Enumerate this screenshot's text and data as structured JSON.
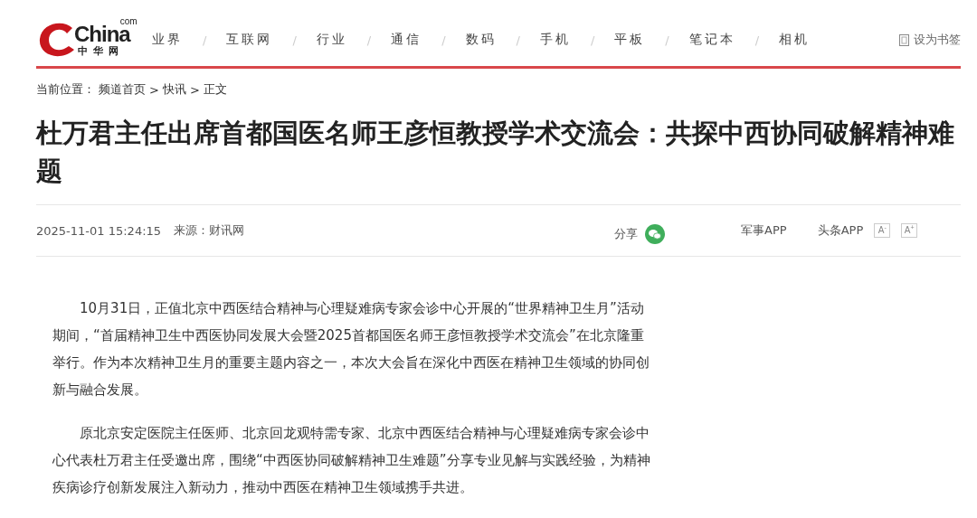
{
  "logo": {
    "word": "China",
    "suffix": "com",
    "subtitle": "中华网"
  },
  "nav": [
    "业界",
    "互联网",
    "行业",
    "通信",
    "数码",
    "手机",
    "平板",
    "笔记本",
    "相机"
  ],
  "nav_separator": "/",
  "bookmark": "设为书签",
  "breadcrumb": {
    "label": "当前位置：",
    "items": [
      "频道首页",
      "快讯",
      "正文"
    ],
    "separator": ">"
  },
  "title": "杜万君主任出席首都国医名师王彦恒教授学术交流会：共探中西协同破解精神难题",
  "meta": {
    "time": "2025-11-01 15:24:15",
    "source": "来源：财讯网",
    "share": "分享",
    "apps": [
      "军事APP",
      "头条APP"
    ],
    "font_buttons": [
      {
        "letter": "A",
        "sign": "-"
      },
      {
        "letter": "A",
        "sign": "+"
      }
    ]
  },
  "paragraphs": [
    "10月31日，正值北京中西医结合精神与心理疑难病专家会诊中心开展的“世界精神卫生月”活动期间，“首届精神卫生中西医协同发展大会暨2025首都国医名师王彦恒教授学术交流会”在北京隆重举行。作为本次精神卫生月的重要主题内容之一，本次大会旨在深化中西医在精神卫生领域的协同创新与融合发展。",
    "原北京安定医院主任医师、北京回龙观特需专家、北京中西医结合精神与心理疑难病专家会诊中心代表杜万君主任受邀出席，围绕“中西医协同破解精神卫生难题”分享专业见解与实践经验，为精神疾病诊疗创新发展注入新动力，推动中西医在精神卫生领域携手共进。"
  ]
}
